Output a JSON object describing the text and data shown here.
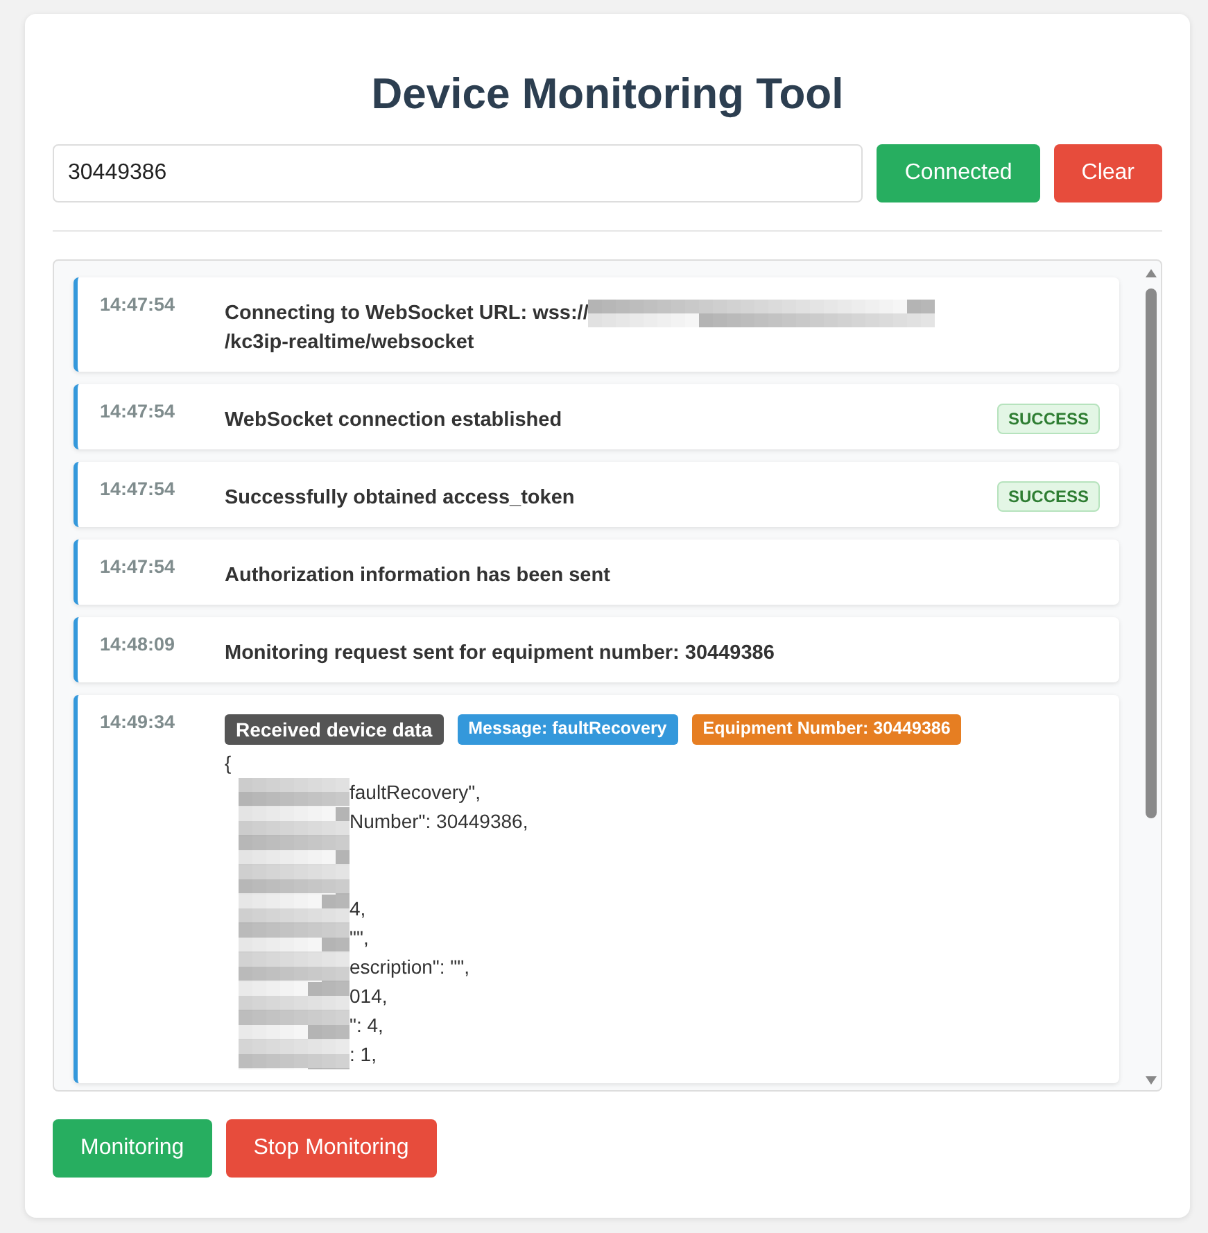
{
  "title": "Device Monitoring Tool",
  "device_input": {
    "value": "30449386"
  },
  "top_buttons": [
    {
      "label": "Connected",
      "kind": "primary"
    },
    {
      "label": "Clear",
      "kind": "danger"
    }
  ],
  "log": [
    {
      "time": "14:47:54",
      "kind": "url",
      "text_before": "Connecting to WebSocket URL: wss://",
      "text_after": "/kc3ip-realtime/websocket"
    },
    {
      "time": "14:47:54",
      "kind": "plain",
      "text": "WebSocket connection established",
      "badge": "SUCCESS"
    },
    {
      "time": "14:47:54",
      "kind": "plain",
      "text": "Successfully obtained access_token",
      "badge": "SUCCESS"
    },
    {
      "time": "14:47:54",
      "kind": "plain",
      "text": "Authorization information has been sent"
    },
    {
      "time": "14:48:09",
      "kind": "plain",
      "text": "Monitoring request sent for equipment number: 30449386"
    },
    {
      "time": "14:49:34",
      "kind": "data",
      "tags": [
        {
          "label": "Received device data",
          "color": "#555555"
        },
        {
          "label": "Message: faultRecovery",
          "color": "#3498db"
        },
        {
          "label": "Equipment Number: 30449386",
          "color": "#e67e22"
        }
      ],
      "lines": [
        {
          "text": "{",
          "redacted": false
        },
        {
          "text": "faultRecovery\",",
          "redacted": true
        },
        {
          "text": "Number\": 30449386,",
          "redacted": true
        },
        {
          "redacted": true
        },
        {
          "redacted": true
        },
        {
          "text": "4,",
          "redacted": true
        },
        {
          "text": "\"\",",
          "redacted": true
        },
        {
          "text": "escription\": \"\",",
          "redacted": true
        },
        {
          "text": "014,",
          "redacted": true
        },
        {
          "text": "\": 4,",
          "redacted": true
        },
        {
          "text": ": 1,",
          "redacted": true
        }
      ]
    }
  ],
  "bottom_buttons": [
    {
      "label": "Monitoring",
      "kind": "primary"
    },
    {
      "label": "Stop Monitoring",
      "kind": "danger"
    }
  ]
}
